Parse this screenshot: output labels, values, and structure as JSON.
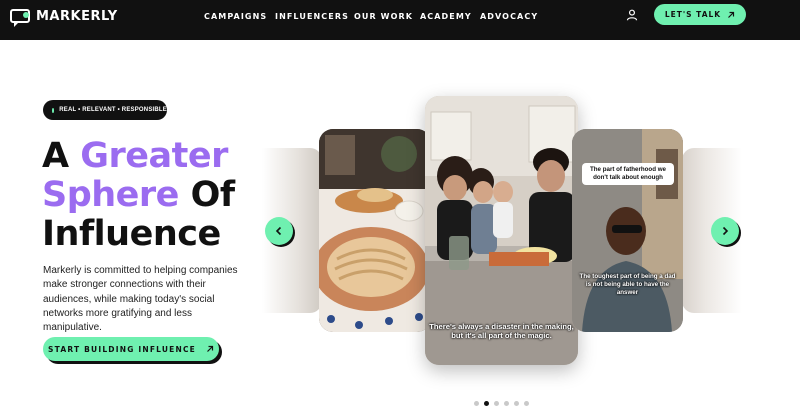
{
  "nav": {
    "logo_text": "MARKERLY",
    "menu": [
      "CAMPAIGNS",
      "INFLUENCERS",
      "OUR WORK",
      "ACADEMY",
      "ADVOCACY"
    ],
    "cta_label": "LET'S TALK",
    "icons": {
      "account": "user-icon",
      "cta": "arrow-up-right-icon"
    }
  },
  "hero": {
    "badge": "REAL • RELEVANT • RESPONSIBLE",
    "headline": {
      "line1_a": "A ",
      "line1_b": "Greater",
      "line2_a": "Sphere",
      "line2_b": " Of",
      "line3": "Influence"
    },
    "description": "Markerly is committed to helping companies make stronger connections with their audiences, while making today's social networks more gratifying and less manipulative.",
    "cta_label": "START BUILDING INFLUENCE"
  },
  "carousel": {
    "center_caption": "There's always a disaster in the making, but it's all part of the magic.",
    "right_bubble": "The part of fatherhood we don't talk about enough",
    "right_caption": "The toughest part of being a dad is not being able to have the answer",
    "dots_count": 6,
    "active_dot": 1,
    "prev_icon": "chevron-left-icon",
    "next_icon": "chevron-right-icon"
  },
  "colors": {
    "accent": "#6ff0b0",
    "purple": "#9b6cf0",
    "dark": "#111111"
  }
}
